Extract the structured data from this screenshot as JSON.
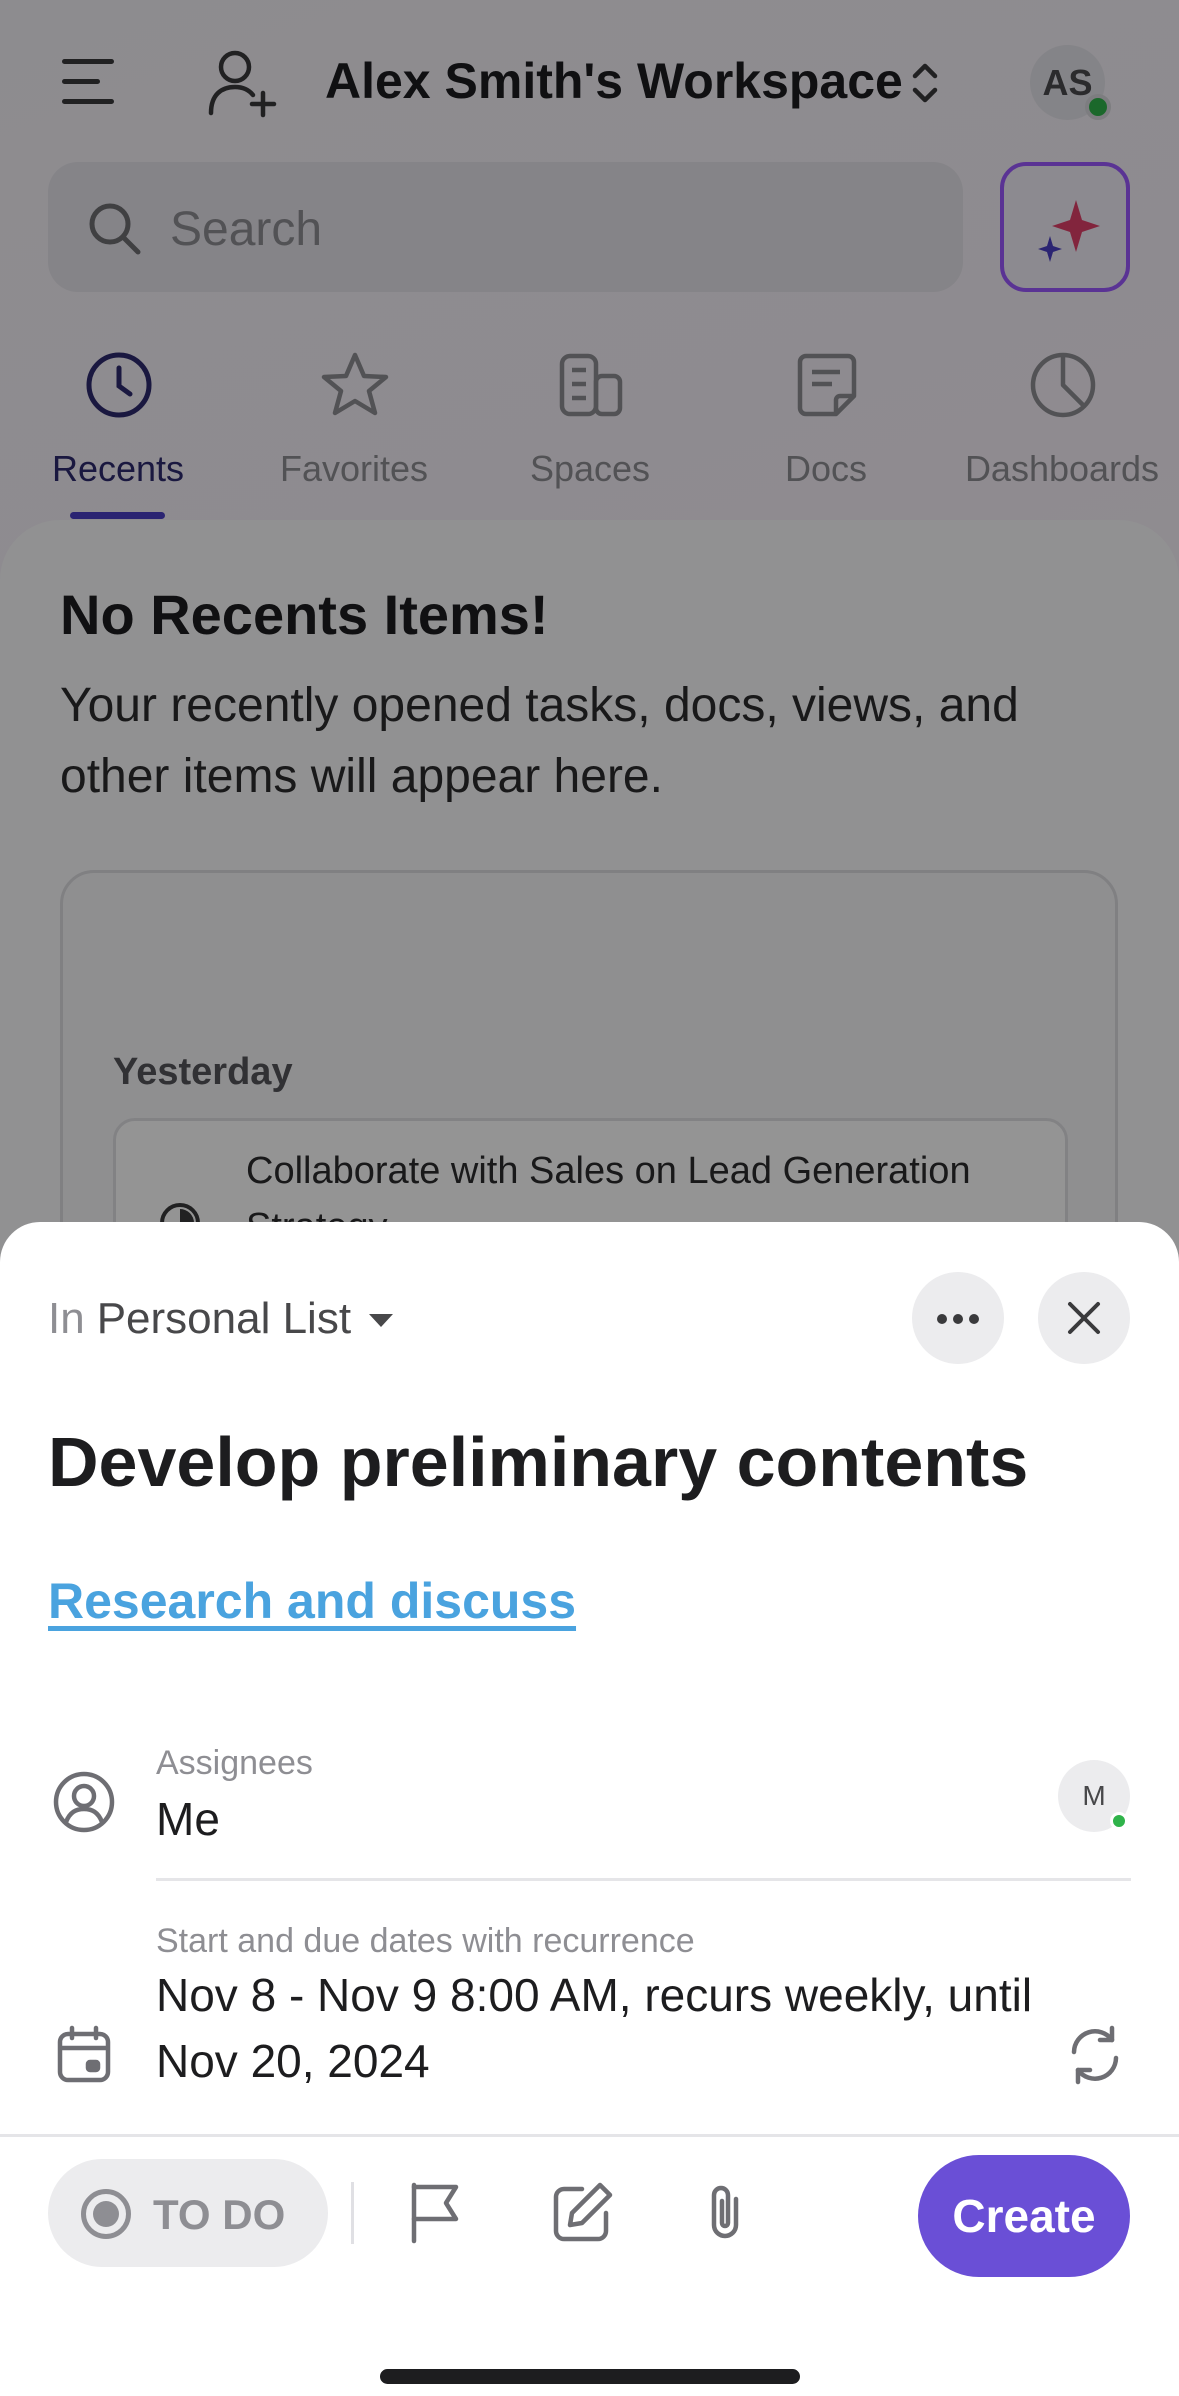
{
  "header": {
    "workspace_title": "Alex Smith's Workspace",
    "avatar_initials": "AS"
  },
  "search": {
    "placeholder": "Search"
  },
  "tabs": [
    {
      "label": "Recents",
      "icon": "clock-icon",
      "active": true
    },
    {
      "label": "Favorites",
      "icon": "star-icon",
      "active": false
    },
    {
      "label": "Spaces",
      "icon": "spaces-icon",
      "active": false
    },
    {
      "label": "Docs",
      "icon": "doc-icon",
      "active": false
    },
    {
      "label": "Dashboards",
      "icon": "pie-chart-icon",
      "active": false
    }
  ],
  "recents": {
    "empty_title": "No Recents Items!",
    "empty_description": "Your recently opened tasks, docs, views, and other items will appear here.",
    "preview_day": "Yesterday",
    "preview_item": "Collaborate with Sales on Lead Generation Strategy"
  },
  "sheet": {
    "list_prefix": "In",
    "list_name": "Personal List",
    "task_title": "Develop preliminary contents",
    "parent_task": "Research and discuss",
    "assignees_label": "Assignees",
    "assignees_value": "Me",
    "assignee_initial": "M",
    "dates_label": "Start and due dates with recurrence",
    "dates_value": "Nov 8 - Nov 9 8:00 AM, recurs weekly, until Nov 20, 2024",
    "status_label": "TO DO",
    "create_label": "Create"
  },
  "colors": {
    "accent": "#6a4fd6",
    "link": "#4aa3df",
    "online": "#2fb34a",
    "active_tab": "#4a3fc4"
  }
}
